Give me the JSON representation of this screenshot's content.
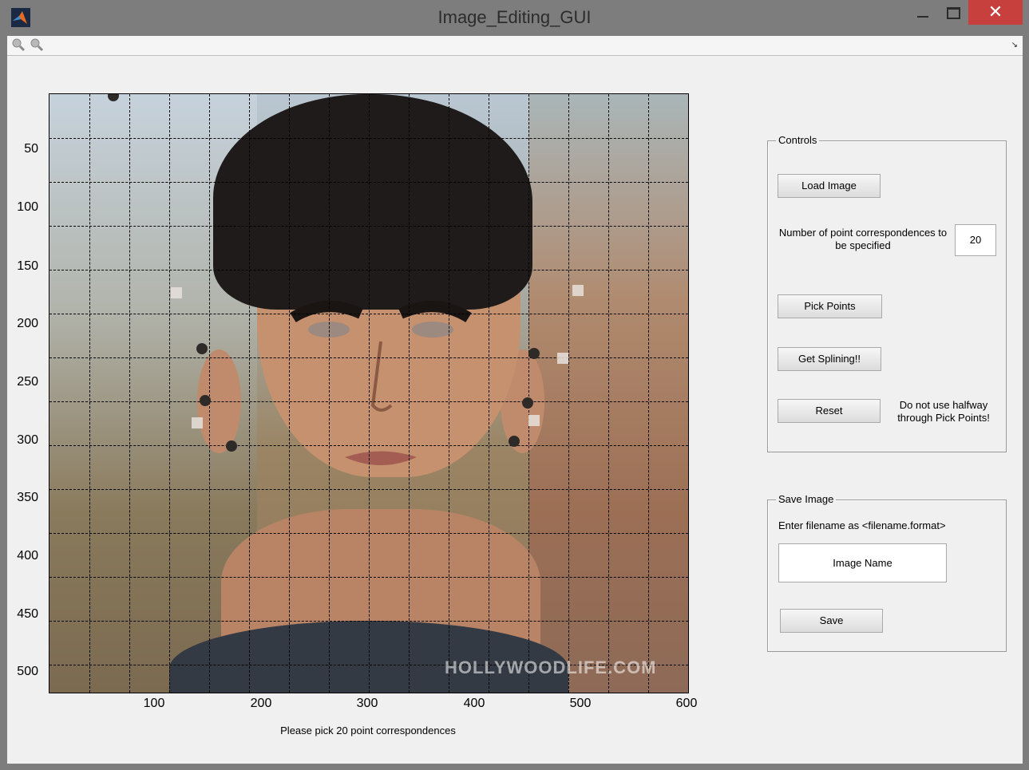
{
  "window": {
    "title": "Image_Editing_GUI",
    "close_glyph": "✕"
  },
  "axes": {
    "y_ticks": [
      "50",
      "100",
      "150",
      "200",
      "250",
      "300",
      "350",
      "400",
      "450",
      "500"
    ],
    "x_ticks": [
      "100",
      "200",
      "300",
      "400",
      "500",
      "600"
    ],
    "watermark": "HOLLYWOODLIFE.COM",
    "status": "Please pick 20 point correspondences"
  },
  "controls": {
    "title": "Controls",
    "load_label": "Load Image",
    "num_points_label": "Number of point correspondences to be specified",
    "num_points_value": "20",
    "pick_label": "Pick Points",
    "spline_label": "Get Splining!!",
    "reset_label": "Reset",
    "warning": "Do not use halfway through Pick Points!"
  },
  "save": {
    "title": "Save Image",
    "instruction": "Enter filename as <filename.format>",
    "filename_value": "Image Name",
    "save_label": "Save"
  }
}
